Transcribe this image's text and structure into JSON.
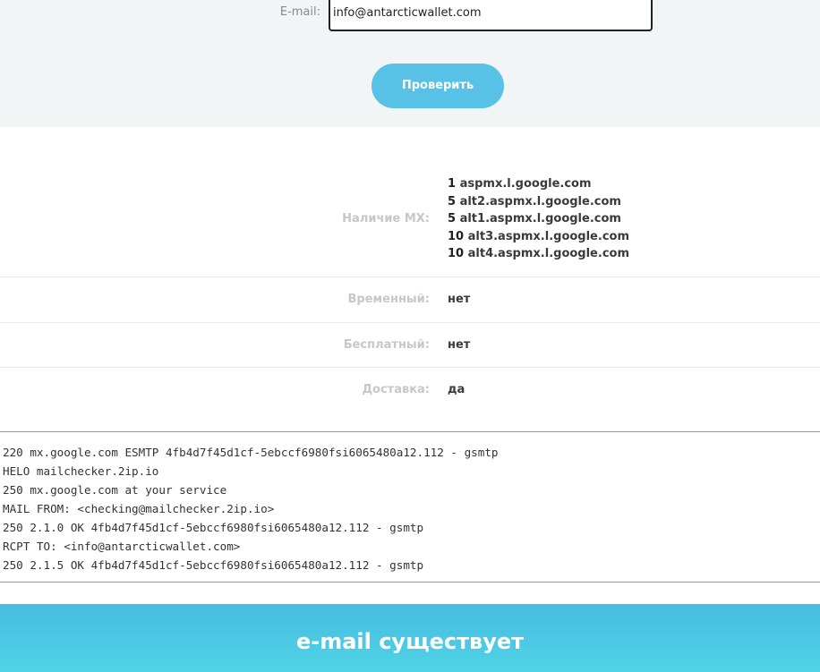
{
  "form": {
    "email_label": "E-mail:",
    "email_value": "info@antarcticwallet.com",
    "check_button": "Проверить"
  },
  "results": {
    "mx": {
      "label": "Наличие MX:",
      "records": [
        {
          "priority": "1",
          "host": "aspmx.l.google.com"
        },
        {
          "priority": "5",
          "host": "alt2.aspmx.l.google.com"
        },
        {
          "priority": "5",
          "host": "alt1.aspmx.l.google.com"
        },
        {
          "priority": "10",
          "host": "alt3.aspmx.l.google.com"
        },
        {
          "priority": "10",
          "host": "alt4.aspmx.l.google.com"
        }
      ]
    },
    "temporary": {
      "label": "Временный:",
      "value": "нет"
    },
    "free": {
      "label": "Бесплатный:",
      "value": "нет"
    },
    "delivery": {
      "label": "Доставка:",
      "value": "да"
    }
  },
  "smtp_log": [
    "220 mx.google.com ESMTP 4fb4d7f45d1cf-5ebccf6980fsi6065480a12.112 - gsmtp",
    "HELO mailchecker.2ip.io",
    "250 mx.google.com at your service",
    "MAIL FROM: <checking@mailchecker.2ip.io>",
    "250 2.1.0 OK 4fb4d7f45d1cf-5ebccf6980fsi6065480a12.112 - gsmtp",
    "RCPT TO: <info@antarcticwallet.com>",
    "250 2.1.5 OK 4fb4d7f45d1cf-5ebccf6980fsi6065480a12.112 - gsmtp"
  ],
  "verdict": "e-mail существует",
  "colors": {
    "accent": "#57c2e6",
    "banner_start": "#48bde2",
    "banner_end": "#4ed3e6",
    "form_bg": "#f2f5f5"
  }
}
